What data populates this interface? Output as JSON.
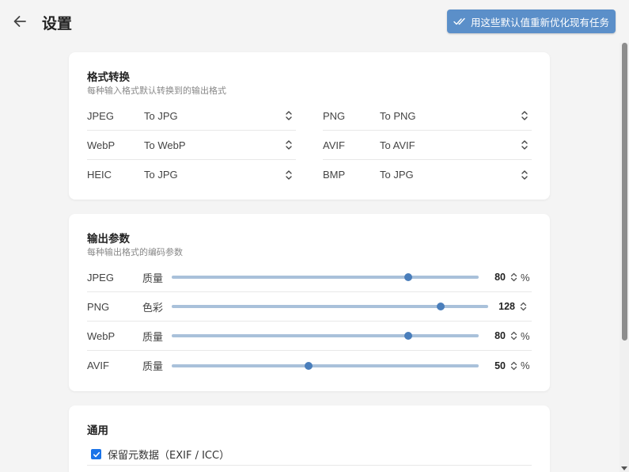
{
  "header": {
    "title": "设置",
    "apply_button": "用这些默认值重新优化现有任务"
  },
  "format_conversion": {
    "title": "格式转换",
    "subtitle": "每种输入格式默认转换到的输出格式",
    "rows": [
      {
        "input": "JPEG",
        "output": "To JPG"
      },
      {
        "input": "PNG",
        "output": "To PNG"
      },
      {
        "input": "WebP",
        "output": "To WebP"
      },
      {
        "input": "AVIF",
        "output": "To AVIF"
      },
      {
        "input": "HEIC",
        "output": "To JPG"
      },
      {
        "input": "BMP",
        "output": "To JPG"
      }
    ]
  },
  "output_params": {
    "title": "输出参数",
    "subtitle": "每种输出格式的编码参数",
    "rows": [
      {
        "format": "JPEG",
        "kind": "质量",
        "value": "80",
        "unit": "%",
        "fraction": 0.77
      },
      {
        "format": "PNG",
        "kind": "色彩",
        "value": "128",
        "unit": "",
        "fraction": 0.85
      },
      {
        "format": "WebP",
        "kind": "质量",
        "value": "80",
        "unit": "%",
        "fraction": 0.77
      },
      {
        "format": "AVIF",
        "kind": "质量",
        "value": "50",
        "unit": "%",
        "fraction": 0.445
      }
    ]
  },
  "general": {
    "title": "通用",
    "keep_metadata": "保留元数据（EXIF / ICC）",
    "keep_metadata_checked": true
  },
  "colors": {
    "accent": "#5b8fc9",
    "slider_track": "#a9c1da",
    "slider_thumb": "#4a7ebb",
    "checkbox": "#1a73e8"
  }
}
